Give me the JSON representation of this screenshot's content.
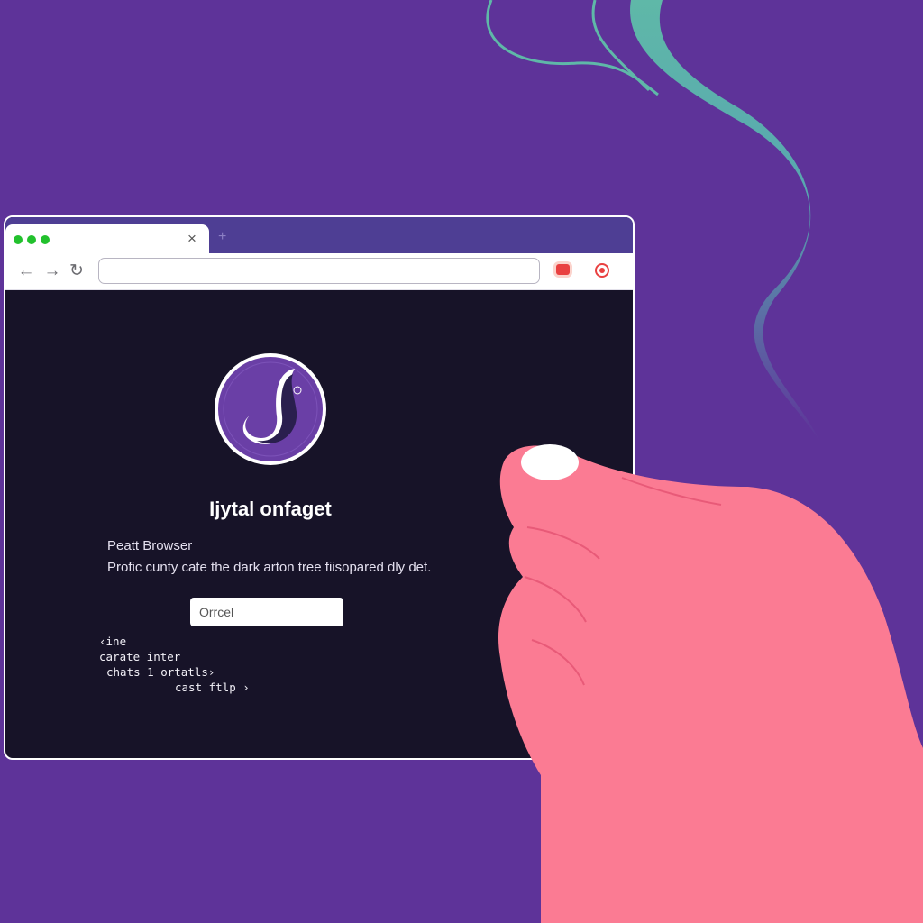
{
  "browser": {
    "tab_close_glyph": "×",
    "new_tab_glyph": "+",
    "back_glyph": "←",
    "forward_glyph": "→",
    "reload_glyph": "↻",
    "address": {
      "value": "",
      "placeholder": ""
    },
    "icons": [
      "back-icon",
      "forward-icon",
      "reload-icon",
      "extension-icon",
      "record-icon",
      "close-icon",
      "plus-icon"
    ]
  },
  "page": {
    "logo_icon": "swirl-logo-icon",
    "title": "Ijytal onfaget",
    "subtitle": "Peatt Browser",
    "description": "Profic cunty cate the dark arton tree fiisopared dly det.",
    "cancel_label": "Orrcel",
    "code_lines": [
      "‹ine",
      "carate inter",
      "chats 1 ortatls›",
      "cast ftlp ›"
    ]
  },
  "colors": {
    "background": "#5e3399",
    "window_content": "#171328",
    "logo_purple": "#6a3fa6",
    "swirl_teal": "#5fb8a8",
    "hand_pink": "#fb7b93",
    "traffic_light_green": "#22c12d",
    "accent_red": "#e94040"
  }
}
